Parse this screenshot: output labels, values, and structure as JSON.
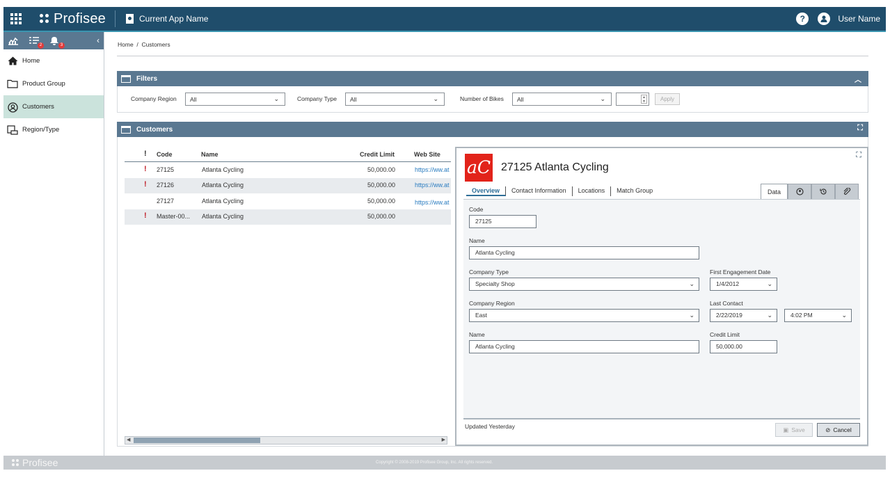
{
  "header": {
    "logo_text": "Profisee",
    "app_name": "Current App Name",
    "help_label": "?",
    "user_name": "User Name"
  },
  "sidebar": {
    "badges": [
      "2",
      "3"
    ],
    "items": [
      {
        "label": "Home",
        "icon": "home-icon"
      },
      {
        "label": "Product Group",
        "icon": "folder-icon"
      },
      {
        "label": "Customers",
        "icon": "user-circle-icon",
        "active": true
      },
      {
        "label": "Region/Type",
        "icon": "hierarchy-icon"
      }
    ]
  },
  "breadcrumb": "Home  /  Customers",
  "filters": {
    "title": "Filters",
    "company_region_label": "Company Region",
    "company_region_value": "All",
    "company_type_label": "Company Type",
    "company_type_value": "All",
    "bikes_label": "Number of Bikes",
    "bikes_value": "All",
    "apply_label": "Apply"
  },
  "customers": {
    "title": "Customers",
    "columns": [
      "!",
      "Code",
      "Name",
      "Credit Limit",
      "Web Site"
    ],
    "rows": [
      {
        "flag": "!",
        "code": "27125",
        "name": "Atlanta Cycling",
        "credit": "50,000.00",
        "web": "https://ww.at"
      },
      {
        "flag": "!",
        "code": "27126",
        "name": "Atlanta Cycling",
        "credit": "50,000.00",
        "web": "https://ww.at"
      },
      {
        "flag": "",
        "code": "27127",
        "name": "Atlanta Cycling",
        "credit": "50,000.00",
        "web": "https://ww.at"
      },
      {
        "flag": "!",
        "code": "Master-00...",
        "name": "Atlanta Cycling",
        "credit": "50,000.00",
        "web": ""
      }
    ]
  },
  "detail": {
    "logo_text": "aC",
    "title": "27125 Atlanta Cycling",
    "tabs": [
      "Overview",
      "Contact Information",
      "Locations",
      "Match Group"
    ],
    "side_tab": "Data",
    "form": {
      "code_label": "Code",
      "code_value": "27125",
      "name_label": "Name",
      "name_value": "Atlanta Cycling",
      "company_type_label": "Company Type",
      "company_type_value": "Specialty Shop",
      "first_engagement_label": "First Engagement Date",
      "first_engagement_value": "1/4/2012",
      "company_region_label": "Company Region",
      "company_region_value": "East",
      "last_contact_label": "Last Contact",
      "last_contact_date": "2/22/2019",
      "last_contact_time": "4:02 PM",
      "name2_label": "Name",
      "name2_value": "Atlanta Cycling",
      "credit_limit_label": "Credit Limit",
      "credit_limit_value": "50,000.00"
    },
    "updated_text": "Updated Yesterday",
    "save_label": "Save",
    "cancel_label": "Cancel"
  },
  "footer": {
    "logo_text": "Profisee",
    "copyright": "Copyright © 2008-2019 Profisee Group, Inc. All rights reserved."
  },
  "colors": {
    "topbar": "#1f4d6b",
    "panel_header": "#5a7891",
    "active_nav": "#cbe3dc",
    "alert_red": "#c0212b",
    "logo_red": "#e2231a"
  }
}
